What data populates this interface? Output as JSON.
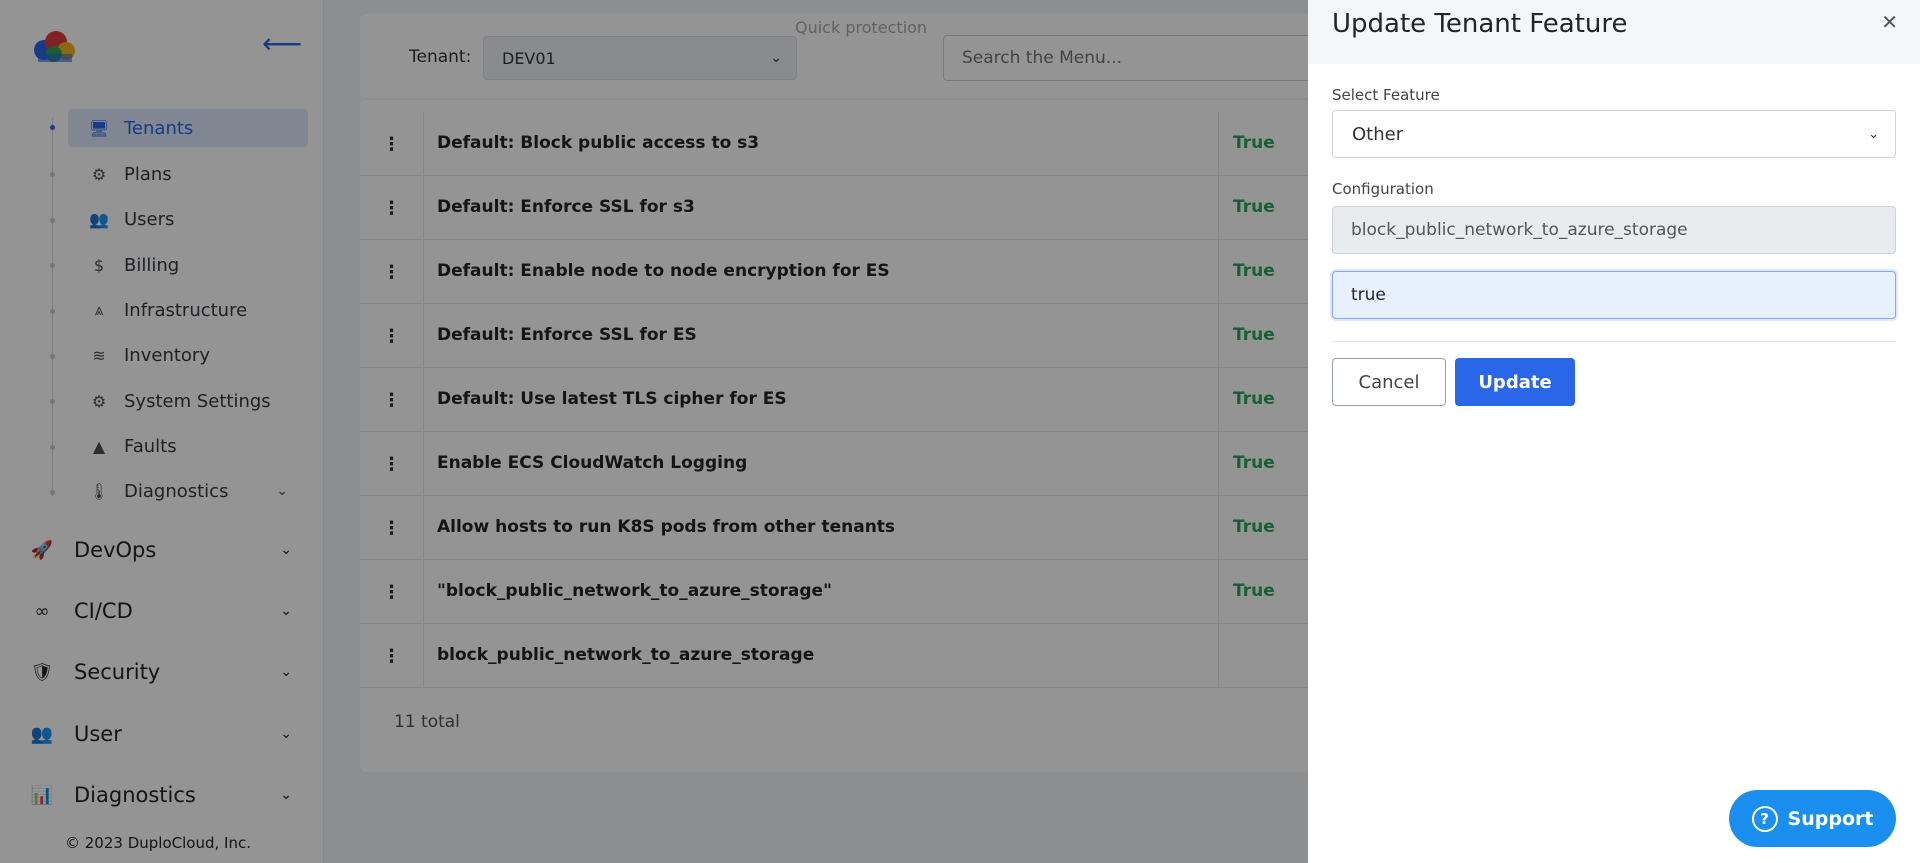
{
  "sidebar": {
    "sub_items": [
      {
        "label": "Tenants",
        "icon": "tenant-icon",
        "active": true
      },
      {
        "label": "Plans",
        "icon": "gear-icon"
      },
      {
        "label": "Users",
        "icon": "users-icon"
      },
      {
        "label": "Billing",
        "icon": "dollar-icon"
      },
      {
        "label": "Infrastructure",
        "icon": "network-icon"
      },
      {
        "label": "Inventory",
        "icon": "layers-icon"
      },
      {
        "label": "System Settings",
        "icon": "gear-icon"
      },
      {
        "label": "Faults",
        "icon": "warning-icon"
      },
      {
        "label": "Diagnostics",
        "icon": "thermometer-icon"
      }
    ],
    "main_items": [
      {
        "label": "DevOps",
        "icon": "rocket-icon"
      },
      {
        "label": "CI/CD",
        "icon": "infinity-icon"
      },
      {
        "label": "Security",
        "icon": "shield-icon"
      },
      {
        "label": "User",
        "icon": "user-group-icon"
      },
      {
        "label": "Diagnostics",
        "icon": "chart-icon"
      }
    ],
    "copyright": "© 2023  DuploCloud, Inc."
  },
  "topbar": {
    "tenant_label": "Tenant:",
    "tenant_value": "DEV01",
    "search_placeholder": "Search the Menu...",
    "faded_text": "Quick protection"
  },
  "table": {
    "rows": [
      {
        "name": "Default: Block public access to s3",
        "value": "True"
      },
      {
        "name": "Default: Enforce SSL for s3",
        "value": "True"
      },
      {
        "name": "Default: Enable node to node encryption for ES",
        "value": "True"
      },
      {
        "name": "Default: Enforce SSL for ES",
        "value": "True"
      },
      {
        "name": "Default: Use latest TLS cipher for ES",
        "value": "True"
      },
      {
        "name": "Enable ECS CloudWatch Logging",
        "value": "True"
      },
      {
        "name": "Allow hosts to run K8S pods from other tenants",
        "value": "True"
      },
      {
        "name": "\"block_public_network_to_azure_storage\"",
        "value": "True"
      },
      {
        "name": "block_public_network_to_azure_storage",
        "value": ""
      }
    ],
    "total": "11 total"
  },
  "drawer": {
    "title": "Update Tenant Feature",
    "select_feature_label": "Select Feature",
    "select_feature_value": "Other",
    "configuration_label": "Configuration",
    "configuration_value": "block_public_network_to_azure_storage",
    "value_input": "true",
    "cancel_label": "Cancel",
    "update_label": "Update"
  },
  "support": {
    "label": "Support"
  },
  "colors": {
    "accent": "#2a66e8",
    "true_green": "#2aa65a",
    "support_blue": "#1b8ff0"
  }
}
